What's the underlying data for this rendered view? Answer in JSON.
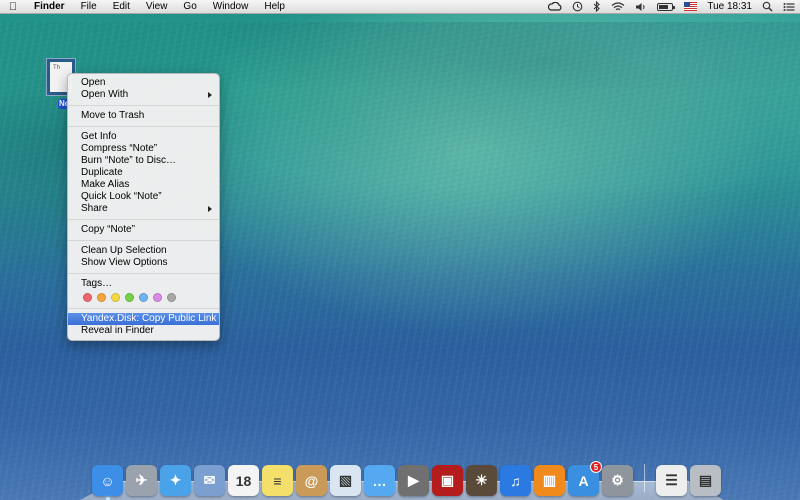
{
  "menubar": {
    "apple": "",
    "items": [
      "Finder",
      "File",
      "Edit",
      "View",
      "Go",
      "Window",
      "Help"
    ],
    "status": {
      "icons": [
        "creative-cloud-icon",
        "time-machine-icon",
        "bluetooth-icon",
        "wifi-icon",
        "volume-icon"
      ],
      "flag": "us-flag-icon",
      "clock": "Tue 18:31",
      "search": "spotlight-icon",
      "list": "notification-center-icon"
    }
  },
  "desktop": {
    "file": {
      "label": "No",
      "thumb_text": "Th"
    }
  },
  "context_menu": {
    "group1": [
      "Open",
      "Open With"
    ],
    "group2": [
      "Move to Trash"
    ],
    "group3": [
      "Get Info",
      "Compress “Note”",
      "Burn “Note” to Disc…",
      "Duplicate",
      "Make Alias",
      "Quick Look “Note”",
      "Share"
    ],
    "group4": [
      "Copy “Note”"
    ],
    "group5": [
      "Clean Up Selection",
      "Show View Options"
    ],
    "tags_label": "Tags…",
    "tag_colors": [
      "#f0646e",
      "#f7a53b",
      "#f5d944",
      "#78d04a",
      "#6fb3f0",
      "#d98be6",
      "#a8a8a8"
    ],
    "highlighted": "Yandex.Disk: Copy Public Link",
    "last": "Reveal in Finder"
  },
  "dock": {
    "apps": [
      {
        "name": "finder-icon",
        "color": "#3d8ee6",
        "glyph": "☺"
      },
      {
        "name": "launchpad-icon",
        "color": "#9aa2ad",
        "glyph": "✈"
      },
      {
        "name": "safari-icon",
        "color": "#4aa3e8",
        "glyph": "✦"
      },
      {
        "name": "mail-icon",
        "color": "#7a9fd0",
        "glyph": "✉"
      },
      {
        "name": "calendar-icon",
        "color": "#f4f4f4",
        "glyph": "18"
      },
      {
        "name": "notes-icon",
        "color": "#f5df6b",
        "glyph": "≡"
      },
      {
        "name": "contacts-icon",
        "color": "#c99a58",
        "glyph": "@"
      },
      {
        "name": "preview-icon",
        "color": "#d9e6f2",
        "glyph": "▧"
      },
      {
        "name": "messages-icon",
        "color": "#55a9f0",
        "glyph": "…"
      },
      {
        "name": "facetime-icon",
        "color": "#707070",
        "glyph": "▶"
      },
      {
        "name": "photo-booth-icon",
        "color": "#b51c1c",
        "glyph": "▣"
      },
      {
        "name": "iphoto-icon",
        "color": "#5a4a3a",
        "glyph": "☀"
      },
      {
        "name": "itunes-icon",
        "color": "#2a7ae2",
        "glyph": "♫"
      },
      {
        "name": "ibooks-icon",
        "color": "#f08a1c",
        "glyph": "▥"
      },
      {
        "name": "app-store-icon",
        "color": "#3a8fe0",
        "glyph": "A",
        "badge": "5"
      },
      {
        "name": "system-preferences-icon",
        "color": "#8f959c",
        "glyph": "⚙"
      }
    ],
    "others": [
      {
        "name": "document-stack-icon",
        "color": "#eeeeee",
        "glyph": "☰"
      },
      {
        "name": "trash-icon",
        "color": "#b9bec4",
        "glyph": "▤"
      }
    ]
  }
}
